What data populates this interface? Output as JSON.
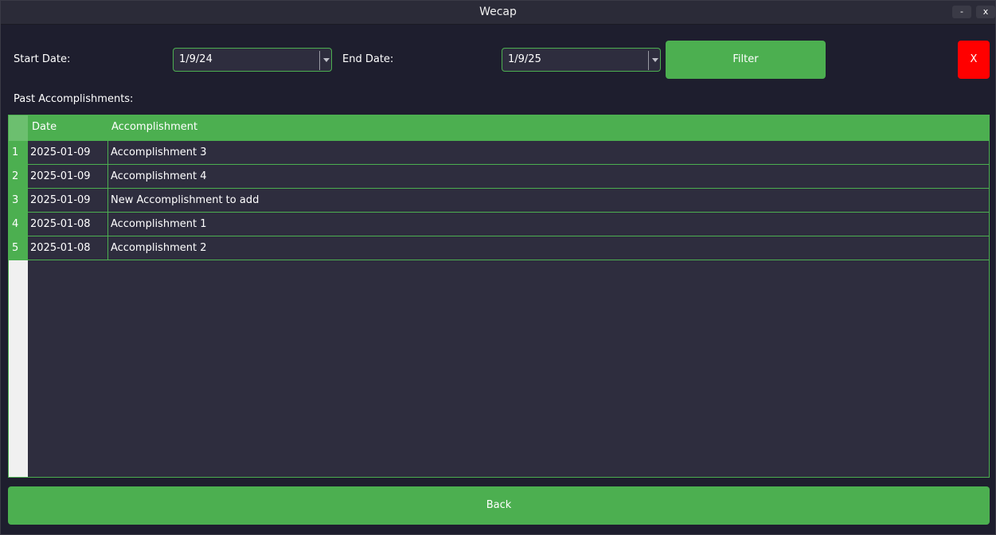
{
  "window": {
    "title": "Wecap",
    "minimize_label": "-",
    "close_label": "x"
  },
  "filters": {
    "start_label": "Start Date:",
    "start_value": "1/9/24",
    "end_label": "End Date:",
    "end_value": "1/9/25",
    "filter_button": "Filter",
    "close_button": "X"
  },
  "section_label": "Past Accomplishments:",
  "table": {
    "columns": [
      "Date",
      "Accomplishment"
    ],
    "rows": [
      {
        "num": "1",
        "date": "2025-01-09",
        "text": "Accomplishment 3"
      },
      {
        "num": "2",
        "date": "2025-01-09",
        "text": "Accomplishment 4"
      },
      {
        "num": "3",
        "date": "2025-01-09",
        "text": "New Accomplishment to add"
      },
      {
        "num": "4",
        "date": "2025-01-08",
        "text": "Accomplishment 1"
      },
      {
        "num": "5",
        "date": "2025-01-08",
        "text": "Accomplishment 2"
      }
    ]
  },
  "back_button": "Back",
  "colors": {
    "accent": "#4caf50",
    "danger": "#ff0000",
    "background": "#1e1e2e",
    "surface": "#2e2d3e"
  }
}
